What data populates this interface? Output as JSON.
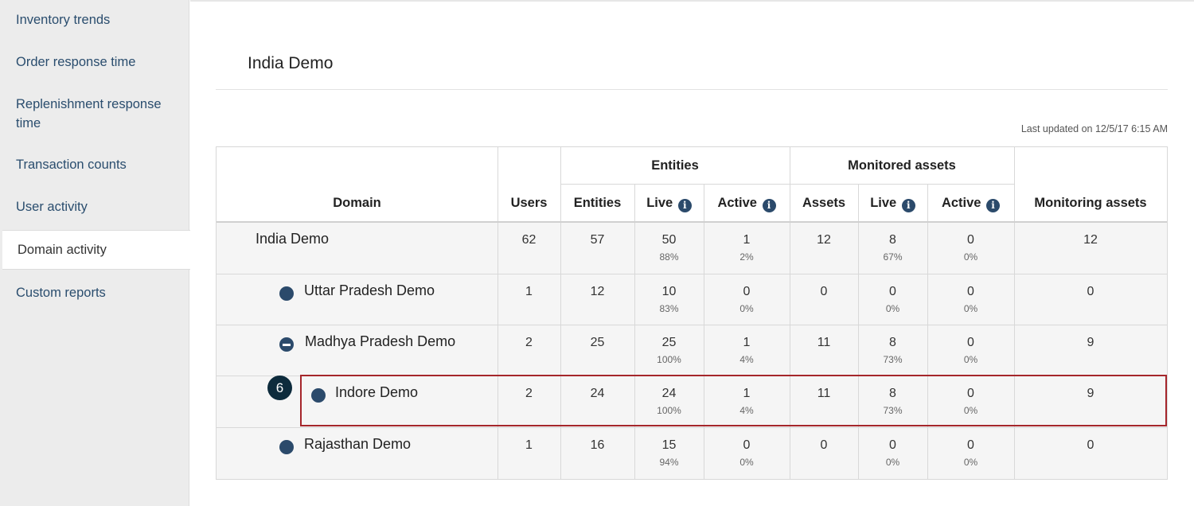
{
  "sidebar": {
    "items": [
      {
        "label": "Inventory trends"
      },
      {
        "label": "Order response time"
      },
      {
        "label": "Replenishment response time"
      },
      {
        "label": "Transaction counts"
      },
      {
        "label": "User activity"
      },
      {
        "label": "Domain activity",
        "active": true
      },
      {
        "label": "Custom reports"
      }
    ]
  },
  "page": {
    "title": "India Demo",
    "last_updated": "Last updated on 12/5/17 6:15 AM"
  },
  "table": {
    "headers": {
      "domain": "Domain",
      "users": "Users",
      "entities_group": "Entities",
      "entities": "Entities",
      "entities_live": "Live",
      "entities_active": "Active",
      "monitored_group": "Monitored assets",
      "assets": "Assets",
      "assets_live": "Live",
      "assets_active": "Active",
      "monitoring_assets": "Monitoring assets"
    },
    "info_icon": "i",
    "rows": [
      {
        "domain": "India Demo",
        "icon": "none",
        "users": "62",
        "entities": "57",
        "e_live": "50",
        "e_live_pct": "88%",
        "e_active": "1",
        "e_active_pct": "2%",
        "assets": "12",
        "a_live": "8",
        "a_live_pct": "67%",
        "a_active": "0",
        "a_active_pct": "0%",
        "monitoring": "12"
      },
      {
        "domain": "Uttar Pradesh Demo",
        "icon": "bullet-icon",
        "users": "1",
        "entities": "12",
        "e_live": "10",
        "e_live_pct": "83%",
        "e_active": "0",
        "e_active_pct": "0%",
        "assets": "0",
        "a_live": "0",
        "a_live_pct": "0%",
        "a_active": "0",
        "a_active_pct": "0%",
        "monitoring": "0"
      },
      {
        "domain": "Madhya Pradesh Demo",
        "icon": "collapse-icon",
        "users": "2",
        "entities": "25",
        "e_live": "25",
        "e_live_pct": "100%",
        "e_active": "1",
        "e_active_pct": "4%",
        "assets": "11",
        "a_live": "8",
        "a_live_pct": "73%",
        "a_active": "0",
        "a_active_pct": "0%",
        "monitoring": "9"
      },
      {
        "domain": "Indore Demo",
        "icon": "bullet-icon",
        "users": "2",
        "entities": "24",
        "e_live": "24",
        "e_live_pct": "100%",
        "e_active": "1",
        "e_active_pct": "4%",
        "assets": "11",
        "a_live": "8",
        "a_live_pct": "73%",
        "a_active": "0",
        "a_active_pct": "0%",
        "monitoring": "9"
      },
      {
        "domain": "Rajasthan Demo",
        "icon": "bullet-icon",
        "users": "1",
        "entities": "16",
        "e_live": "15",
        "e_live_pct": "94%",
        "e_active": "0",
        "e_active_pct": "0%",
        "assets": "0",
        "a_live": "0",
        "a_live_pct": "0%",
        "a_active": "0",
        "a_active_pct": "0%",
        "monitoring": "0"
      }
    ]
  },
  "annotation": {
    "step": "6"
  },
  "colors": {
    "accent": "#2b4a6b",
    "highlight": "#a5262b",
    "badge": "#0d2b3c"
  }
}
